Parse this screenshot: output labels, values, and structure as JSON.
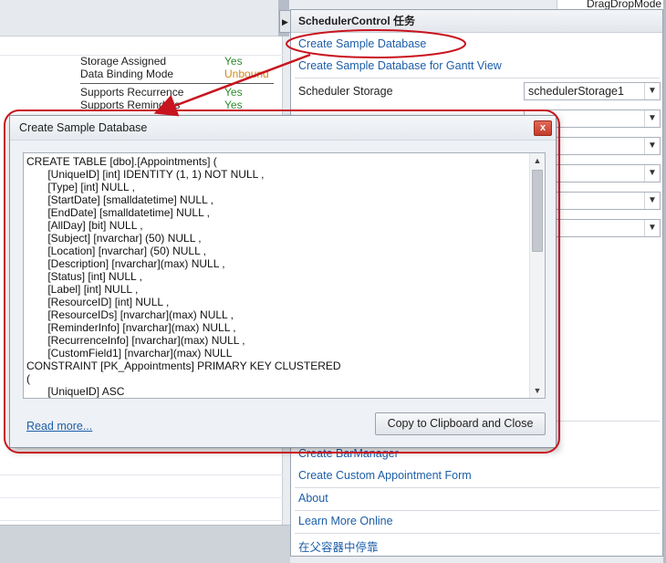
{
  "background": {
    "right_edge_text": "DragDropMode",
    "properties": [
      {
        "key": "Storage Assigned",
        "value": "Yes",
        "warn": false
      },
      {
        "key": "Data Binding Mode",
        "value": "Unbound",
        "warn": true
      },
      {
        "key": "Supports Recurrence",
        "value": "Yes",
        "warn": false
      },
      {
        "key": "Supports Reminders",
        "value": "Yes",
        "warn": false
      }
    ]
  },
  "tasks_panel": {
    "title": "SchedulerControl 任务",
    "link_create_sample_db": "Create Sample Database",
    "link_create_sample_db_gantt": "Create Sample Database for Gantt View",
    "scheduler_storage_label": "Scheduler Storage",
    "scheduler_storage_value": "schedulerStorage1",
    "link_create_barmanager": "Create BarManager",
    "link_create_custom_form": "Create Custom Appointment Form",
    "link_about": "About",
    "link_learn_more": "Learn More Online",
    "link_dock_parent": "在父容器中停靠"
  },
  "dialog": {
    "title": "Create Sample Database",
    "close_label": "x",
    "code": "CREATE TABLE [dbo].[Appointments] (\n       [UniqueID] [int] IDENTITY (1, 1) NOT NULL ,\n       [Type] [int] NULL ,\n       [StartDate] [smalldatetime] NULL ,\n       [EndDate] [smalldatetime] NULL ,\n       [AllDay] [bit] NULL ,\n       [Subject] [nvarchar] (50) NULL ,\n       [Location] [nvarchar] (50) NULL ,\n       [Description] [nvarchar](max) NULL ,\n       [Status] [int] NULL ,\n       [Label] [int] NULL ,\n       [ResourceID] [int] NULL ,\n       [ResourceIDs] [nvarchar](max) NULL ,\n       [ReminderInfo] [nvarchar](max) NULL ,\n       [RecurrenceInfo] [nvarchar](max) NULL ,\n       [CustomField1] [nvarchar](max) NULL\nCONSTRAINT [PK_Appointments] PRIMARY KEY CLUSTERED\n(\n       [UniqueID] ASC",
    "read_more": "Read more...",
    "copy_button": "Copy to Clipboard and Close"
  },
  "colors": {
    "link": "#1d5ea8",
    "annotation": "#c8141e",
    "yes_value": "#2d8a2d",
    "warn_value": "#d08a1a"
  }
}
